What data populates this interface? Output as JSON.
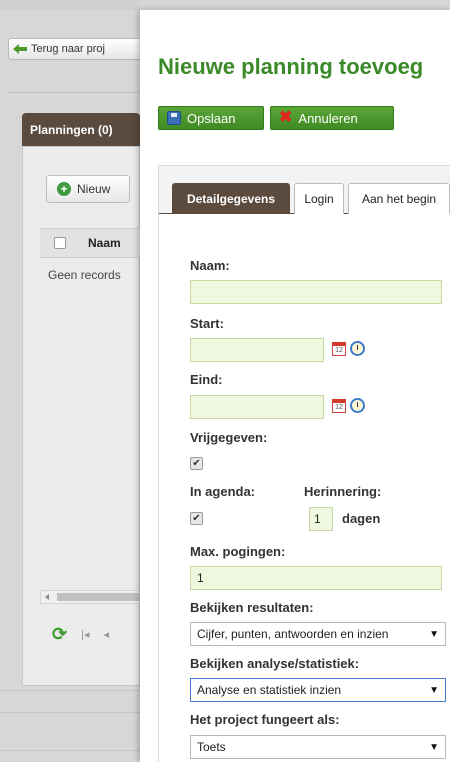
{
  "background_app": {
    "back_button_label": "Terug naar proj",
    "plannings_tab_label": "Planningen (0)",
    "new_button_label": "Nieuw",
    "grid_column_name": "Naam",
    "no_records_text": "Geen records",
    "pager_first": "|◂",
    "pager_prev": "◂"
  },
  "modal": {
    "title": "Nieuwe planning toevoeg",
    "save_label": "Opslaan",
    "cancel_label": "Annuleren",
    "tabs": [
      {
        "label": "Detailgegevens",
        "active": true
      },
      {
        "label": "Login",
        "active": false
      },
      {
        "label": "Aan het begin",
        "active": false
      }
    ],
    "fields": {
      "name_label": "Naam:",
      "name_value": "",
      "start_label": "Start:",
      "start_value": "",
      "end_label": "Eind:",
      "end_value": "",
      "released_label": "Vrijgegeven:",
      "released_checked": "✔",
      "in_agenda_label": "In agenda:",
      "in_agenda_checked": "✔",
      "reminder_label": "Herinnering:",
      "reminder_value": "1",
      "reminder_unit": "dagen",
      "max_attempts_label": "Max. pogingen:",
      "max_attempts_value": "1",
      "view_results_label": "Bekijken resultaten:",
      "view_results_value": "Cijfer, punten, antwoorden en inzien",
      "view_analysis_label": "Bekijken analyse/statistiek:",
      "view_analysis_value": "Analyse en statistiek inzien",
      "project_acts_as_label": "Het project fungeert als:",
      "project_acts_as_value": "Toets"
    }
  },
  "icons": {
    "calendar": "calendar-icon",
    "calendar_day": "12",
    "clock": "clock-icon",
    "caret": "▼"
  },
  "colors": {
    "accent_green": "#3a8a2a",
    "tab_brown": "#5b4a3e",
    "input_green_bg": "#eff7df"
  }
}
